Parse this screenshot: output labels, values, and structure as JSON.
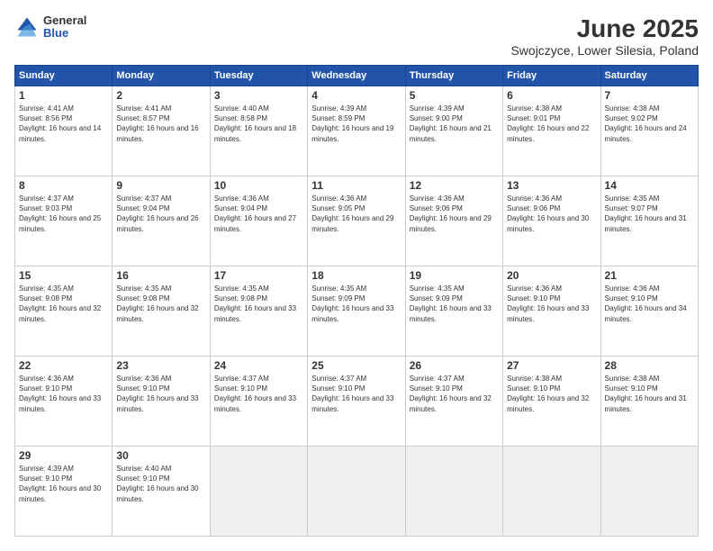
{
  "header": {
    "logo_general": "General",
    "logo_blue": "Blue",
    "title": "June 2025",
    "subtitle": "Swojczyce, Lower Silesia, Poland"
  },
  "calendar": {
    "days_of_week": [
      "Sunday",
      "Monday",
      "Tuesday",
      "Wednesday",
      "Thursday",
      "Friday",
      "Saturday"
    ],
    "weeks": [
      [
        {
          "day": "",
          "empty": true
        },
        {
          "day": "",
          "empty": true
        },
        {
          "day": "",
          "empty": true
        },
        {
          "day": "",
          "empty": true
        },
        {
          "day": "",
          "empty": true
        },
        {
          "day": "",
          "empty": true
        },
        {
          "day": "",
          "empty": true
        }
      ],
      [
        {
          "day": "1",
          "sunrise": "4:41 AM",
          "sunset": "8:56 PM",
          "daylight": "16 hours and 14 minutes."
        },
        {
          "day": "2",
          "sunrise": "4:41 AM",
          "sunset": "8:57 PM",
          "daylight": "16 hours and 16 minutes."
        },
        {
          "day": "3",
          "sunrise": "4:40 AM",
          "sunset": "8:58 PM",
          "daylight": "16 hours and 18 minutes."
        },
        {
          "day": "4",
          "sunrise": "4:39 AM",
          "sunset": "8:59 PM",
          "daylight": "16 hours and 19 minutes."
        },
        {
          "day": "5",
          "sunrise": "4:39 AM",
          "sunset": "9:00 PM",
          "daylight": "16 hours and 21 minutes."
        },
        {
          "day": "6",
          "sunrise": "4:38 AM",
          "sunset": "9:01 PM",
          "daylight": "16 hours and 22 minutes."
        },
        {
          "day": "7",
          "sunrise": "4:38 AM",
          "sunset": "9:02 PM",
          "daylight": "16 hours and 24 minutes."
        }
      ],
      [
        {
          "day": "8",
          "sunrise": "4:37 AM",
          "sunset": "9:03 PM",
          "daylight": "16 hours and 25 minutes."
        },
        {
          "day": "9",
          "sunrise": "4:37 AM",
          "sunset": "9:04 PM",
          "daylight": "16 hours and 26 minutes."
        },
        {
          "day": "10",
          "sunrise": "4:36 AM",
          "sunset": "9:04 PM",
          "daylight": "16 hours and 27 minutes."
        },
        {
          "day": "11",
          "sunrise": "4:36 AM",
          "sunset": "9:05 PM",
          "daylight": "16 hours and 29 minutes."
        },
        {
          "day": "12",
          "sunrise": "4:36 AM",
          "sunset": "9:06 PM",
          "daylight": "16 hours and 29 minutes."
        },
        {
          "day": "13",
          "sunrise": "4:36 AM",
          "sunset": "9:06 PM",
          "daylight": "16 hours and 30 minutes."
        },
        {
          "day": "14",
          "sunrise": "4:35 AM",
          "sunset": "9:07 PM",
          "daylight": "16 hours and 31 minutes."
        }
      ],
      [
        {
          "day": "15",
          "sunrise": "4:35 AM",
          "sunset": "9:08 PM",
          "daylight": "16 hours and 32 minutes."
        },
        {
          "day": "16",
          "sunrise": "4:35 AM",
          "sunset": "9:08 PM",
          "daylight": "16 hours and 32 minutes."
        },
        {
          "day": "17",
          "sunrise": "4:35 AM",
          "sunset": "9:08 PM",
          "daylight": "16 hours and 33 minutes."
        },
        {
          "day": "18",
          "sunrise": "4:35 AM",
          "sunset": "9:09 PM",
          "daylight": "16 hours and 33 minutes."
        },
        {
          "day": "19",
          "sunrise": "4:35 AM",
          "sunset": "9:09 PM",
          "daylight": "16 hours and 33 minutes."
        },
        {
          "day": "20",
          "sunrise": "4:36 AM",
          "sunset": "9:10 PM",
          "daylight": "16 hours and 33 minutes."
        },
        {
          "day": "21",
          "sunrise": "4:36 AM",
          "sunset": "9:10 PM",
          "daylight": "16 hours and 34 minutes."
        }
      ],
      [
        {
          "day": "22",
          "sunrise": "4:36 AM",
          "sunset": "9:10 PM",
          "daylight": "16 hours and 33 minutes."
        },
        {
          "day": "23",
          "sunrise": "4:36 AM",
          "sunset": "9:10 PM",
          "daylight": "16 hours and 33 minutes."
        },
        {
          "day": "24",
          "sunrise": "4:37 AM",
          "sunset": "9:10 PM",
          "daylight": "16 hours and 33 minutes."
        },
        {
          "day": "25",
          "sunrise": "4:37 AM",
          "sunset": "9:10 PM",
          "daylight": "16 hours and 33 minutes."
        },
        {
          "day": "26",
          "sunrise": "4:37 AM",
          "sunset": "9:10 PM",
          "daylight": "16 hours and 32 minutes."
        },
        {
          "day": "27",
          "sunrise": "4:38 AM",
          "sunset": "9:10 PM",
          "daylight": "16 hours and 32 minutes."
        },
        {
          "day": "28",
          "sunrise": "4:38 AM",
          "sunset": "9:10 PM",
          "daylight": "16 hours and 31 minutes."
        }
      ],
      [
        {
          "day": "29",
          "sunrise": "4:39 AM",
          "sunset": "9:10 PM",
          "daylight": "16 hours and 30 minutes."
        },
        {
          "day": "30",
          "sunrise": "4:40 AM",
          "sunset": "9:10 PM",
          "daylight": "16 hours and 30 minutes."
        },
        {
          "day": "",
          "empty": true
        },
        {
          "day": "",
          "empty": true
        },
        {
          "day": "",
          "empty": true
        },
        {
          "day": "",
          "empty": true
        },
        {
          "day": "",
          "empty": true
        }
      ]
    ]
  }
}
